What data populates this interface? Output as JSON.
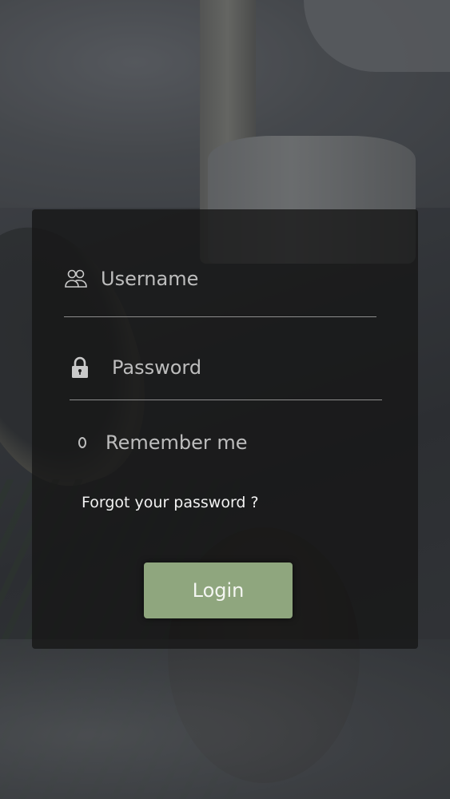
{
  "login_form": {
    "username_placeholder": "Username",
    "password_placeholder": "Password",
    "remember_label": "Remember me",
    "forgot_password": "Forgot your password ?",
    "login_button": "Login"
  },
  "icons": {
    "username": "users-icon",
    "password": "lock-icon",
    "remember": "radio-circle"
  },
  "colors": {
    "panel": "#161616",
    "login_button": "#8fa67e",
    "text": "#bdbdbd",
    "link": "#f2f2f2"
  }
}
